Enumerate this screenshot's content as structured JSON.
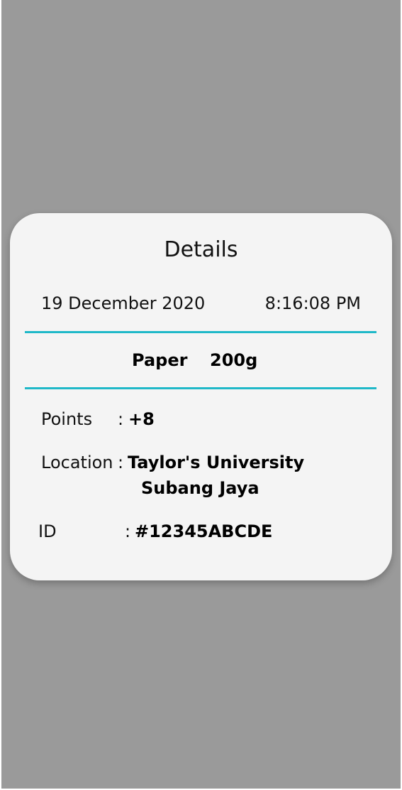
{
  "details": {
    "title": "Details",
    "date": "19 December 2020",
    "time": "8:16:08 PM",
    "material": "Paper",
    "weight": "200g",
    "points": {
      "label": "Points",
      "colon": ":",
      "value": "+8"
    },
    "location": {
      "label": "Location",
      "colon": ":",
      "line1": "Taylor's University",
      "line2": "Subang Jaya"
    },
    "id": {
      "label": "ID",
      "colon": ":",
      "value": "#12345ABCDE"
    }
  },
  "colors": {
    "backdrop": "#9a9a9a",
    "card": "#f4f4f4",
    "accent_rule": "#1fb8c8"
  }
}
